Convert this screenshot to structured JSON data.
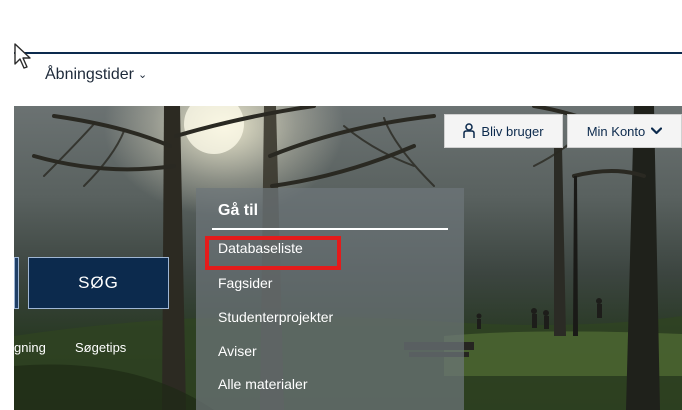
{
  "header": {
    "hours_label": "Åbningstider",
    "hours_chevron": "⌄"
  },
  "account": {
    "signup_label": "Bliv bruger",
    "my_account_label": "Min Konto",
    "account_chevron": "❯"
  },
  "search": {
    "button_label": "SØG",
    "links": [
      "gning",
      "Søgetips"
    ]
  },
  "goto_menu": {
    "heading": "Gå til",
    "items": [
      "Databaseliste",
      "Fagsider",
      "Studenterprojekter",
      "Aviser",
      "Alle materialer"
    ]
  },
  "colors": {
    "brand_navy": "#0c2a4d",
    "highlight_red": "#e41b1b"
  },
  "icons": {
    "signup": "person-icon",
    "account": "chevron-down-icon",
    "hours": "chevron-down-icon",
    "pointer": "mouse-pointer-icon"
  }
}
